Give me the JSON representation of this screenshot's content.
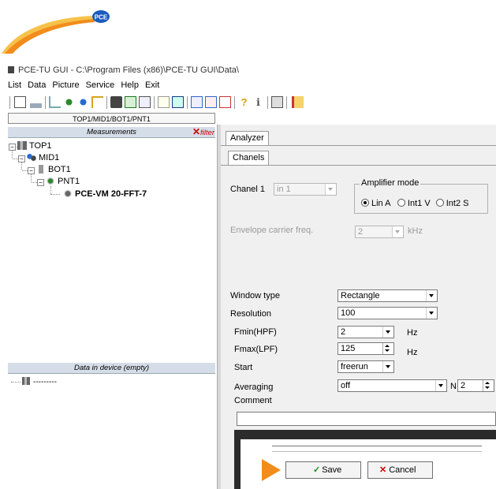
{
  "brand": {
    "logo_text": "PCE",
    "accent": "#f28c1b",
    "logo_blue": "#1a5bbf"
  },
  "window": {
    "title": "PCE-TU GUI - C:\\Program Files (x86)\\PCE-TU GUI\\Data\\"
  },
  "menu": [
    "List",
    "Data",
    "Picture",
    "Service",
    "Help",
    "Exit"
  ],
  "toolbar_icons": [
    "properties-icon",
    "chart-icon",
    "import-icon",
    "add-node-icon",
    "add-node-icon",
    "tree-icon",
    "print-icon",
    "grid-icon",
    "chart-view-icon",
    "tree-view-icon",
    "table-icon",
    "list-icon",
    "list-tree-icon",
    "frame-icon",
    "help-icon",
    "info-icon",
    "tools-icon",
    "exit-icon"
  ],
  "path": "TOP1/MID1/BOT1/PNT1",
  "measurements": {
    "header": "Measurements",
    "filter_label": "filter",
    "tree": [
      {
        "label": "TOP1"
      },
      {
        "label": "MID1"
      },
      {
        "label": "BOT1"
      },
      {
        "label": "PNT1"
      },
      {
        "label": "PCE-VM 20-FFT-7"
      }
    ]
  },
  "data_in_device": {
    "header": "Data in device (empty)",
    "item": "---------"
  },
  "tabs": {
    "outer": "Analyzer",
    "inner": "Chanels"
  },
  "form": {
    "chanel_label": "Chanel 1",
    "chanel_value": "in 1",
    "amplifier_title": "Amplifier mode",
    "amplifier_options": [
      "Lin A",
      "Int1 V",
      "Int2 S"
    ],
    "envelope_label": "Envelope carrier freq.",
    "envelope_value": "2",
    "envelope_unit": "kHz",
    "window_type_label": "Window type",
    "window_type_value": "Rectangle",
    "resolution_label": "Resolution",
    "resolution_value": "100",
    "fmin_label": "Fmin(HPF)",
    "fmin_value": "2",
    "fmin_unit": "Hz",
    "fmax_label": "Fmax(LPF)",
    "fmax_value": "125",
    "fmax_unit": "Hz",
    "start_label": "Start",
    "start_value": "freerun",
    "averaging_label": "Averaging",
    "averaging_value": "off",
    "n_label": "N",
    "n_value": "2",
    "comment_label": "Comment",
    "comment_value": ""
  },
  "buttons": {
    "save": "Save",
    "cancel": "Cancel"
  }
}
